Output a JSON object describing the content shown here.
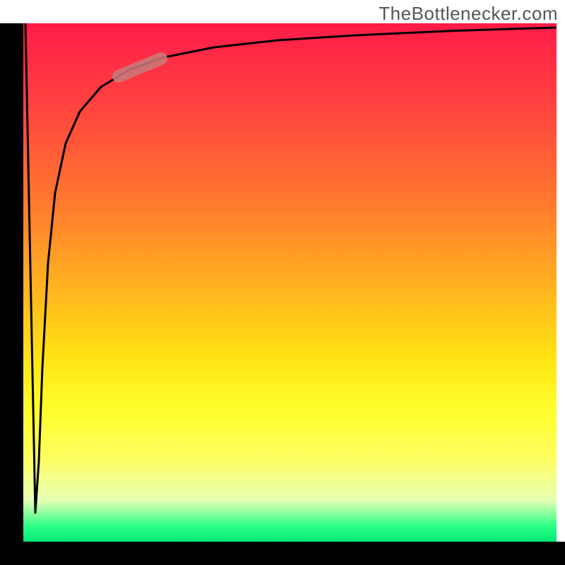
{
  "watermark": "TheBottlenecker.com",
  "colors": {
    "gradient_top": "#ff1c48",
    "gradient_mid": "#ffff2e",
    "gradient_bottom": "#00e878",
    "curve": "#000000",
    "highlight": "#c97b7b",
    "axis": "#000000"
  },
  "chart_data": {
    "type": "line",
    "title": "",
    "xlabel": "",
    "ylabel": "",
    "xlim": [
      0,
      100
    ],
    "ylim": [
      0,
      100
    ],
    "series": [
      {
        "name": "curve",
        "x": [
          0.4,
          2.3,
          2.9,
          3.6,
          4.6,
          6.0,
          7.9,
          10.6,
          14.6,
          19.9,
          26.5,
          35.8,
          47.7,
          62.3,
          79.5,
          100.0
        ],
        "y": [
          100.0,
          5.6,
          15.5,
          33.5,
          53.7,
          67.3,
          76.8,
          83.0,
          87.7,
          91.0,
          93.5,
          95.4,
          96.7,
          97.7,
          98.5,
          99.2
        ]
      }
    ],
    "annotations": [
      {
        "name": "highlight-segment",
        "x_range": [
          17.9,
          25.8
        ],
        "y_range": [
          89.8,
          93.2
        ],
        "color": "#c97b7b"
      }
    ],
    "background": {
      "type": "vertical-gradient",
      "stops": [
        {
          "pos": 0.0,
          "color": "#ff1c48"
        },
        {
          "pos": 0.35,
          "color": "#ff7a2e"
        },
        {
          "pos": 0.65,
          "color": "#ffe514"
        },
        {
          "pos": 0.92,
          "color": "#e6ffb4"
        },
        {
          "pos": 1.0,
          "color": "#00e878"
        }
      ]
    }
  }
}
